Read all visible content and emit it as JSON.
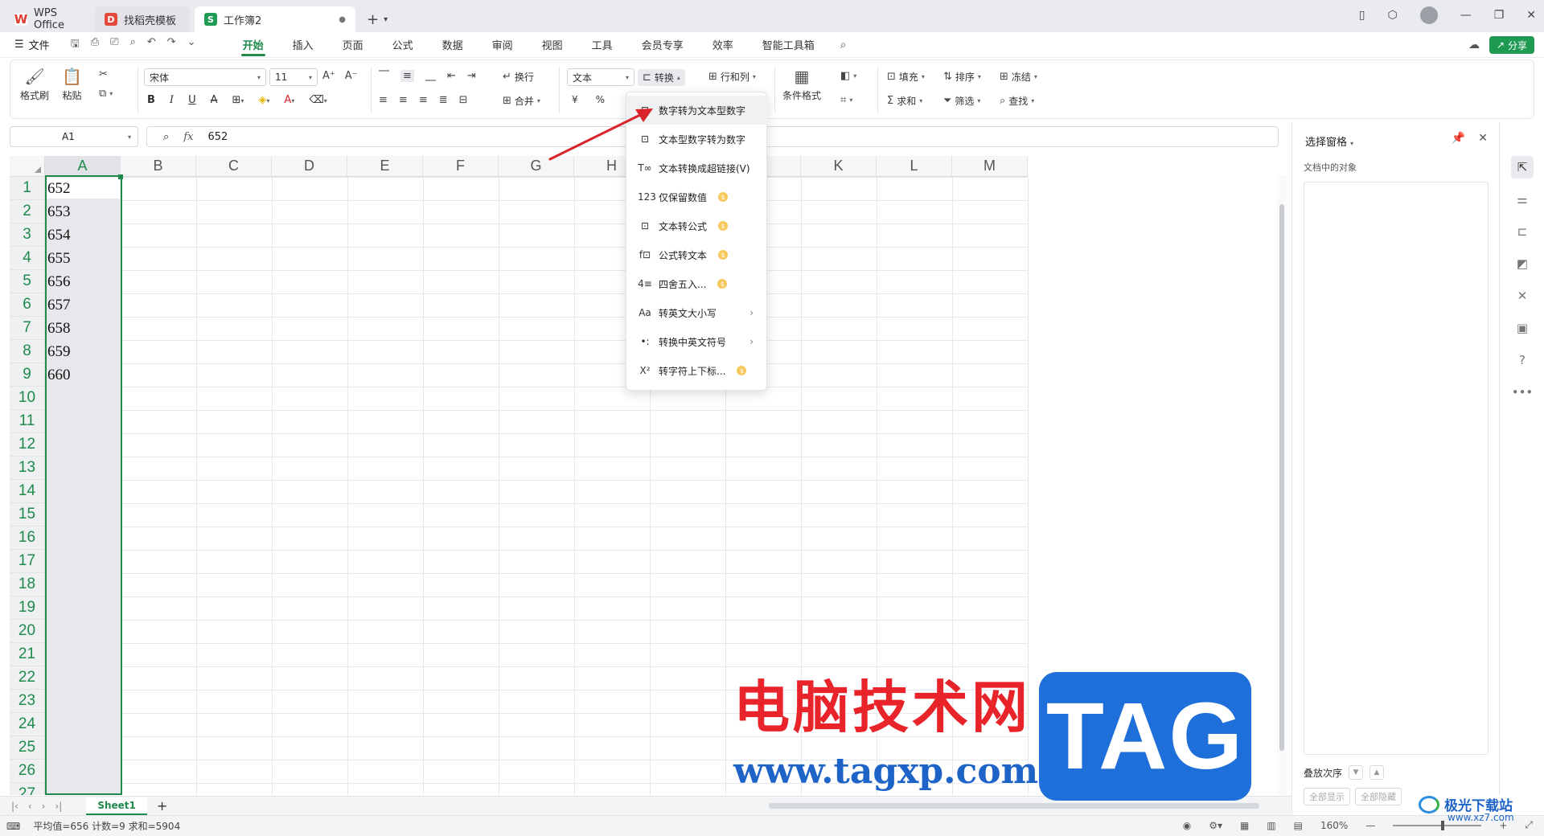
{
  "tabs": [
    {
      "label": "WPS Office",
      "logo": "W"
    },
    {
      "label": "找稻壳模板",
      "logo": "D"
    },
    {
      "label": "工作簿2",
      "logo": "S"
    }
  ],
  "menu": {
    "file": "文件",
    "items": [
      "开始",
      "插入",
      "页面",
      "公式",
      "数据",
      "审阅",
      "视图",
      "工具",
      "会员专享",
      "效率",
      "智能工具箱"
    ],
    "active": "开始",
    "share": "分享"
  },
  "ribbon": {
    "format_painter": "格式刷",
    "paste": "粘贴",
    "font_name": "宋体",
    "font_size": "11",
    "wrap": "换行",
    "merge": "合并",
    "number_format": "文本",
    "convert": "转换",
    "row_col": "行和列",
    "cond_format": "条件格式",
    "fill": "填充",
    "sort": "排序",
    "freeze": "冻结",
    "sum": "求和",
    "filter": "筛选",
    "find": "查找",
    "currency": "¥",
    "percent": "%"
  },
  "formula_bar": {
    "name_box": "A1",
    "fx": "fx",
    "value": "652"
  },
  "grid": {
    "columns": [
      "A",
      "B",
      "C",
      "D",
      "E",
      "F",
      "G",
      "H",
      "I",
      "J",
      "K",
      "L",
      "M"
    ],
    "rows": [
      "1",
      "2",
      "3",
      "4",
      "5",
      "6",
      "7",
      "8",
      "9",
      "10",
      "11",
      "12",
      "13",
      "14",
      "15",
      "16",
      "17",
      "18",
      "19",
      "20",
      "21",
      "22",
      "23",
      "24",
      "25",
      "26",
      "27"
    ],
    "colA_values": [
      "652",
      "653",
      "654",
      "655",
      "656",
      "657",
      "658",
      "659",
      "660"
    ]
  },
  "dropdown": {
    "items": [
      {
        "label": "数字转为文本型数字",
        "icon": "num-to-text-icon",
        "glyph": "⊡",
        "coin": false,
        "submenu": false
      },
      {
        "label": "文本型数字转为数字",
        "icon": "text-to-num-icon",
        "glyph": "⊡",
        "coin": false,
        "submenu": false
      },
      {
        "label": "文本转换成超链接(V)",
        "icon": "hyperlink-icon",
        "glyph": "T∞",
        "coin": false,
        "submenu": false
      },
      {
        "label": "仅保留数值",
        "icon": "keep-values-icon",
        "glyph": "123",
        "coin": true,
        "submenu": false
      },
      {
        "label": "文本转公式",
        "icon": "text-to-formula-icon",
        "glyph": "⊡",
        "coin": true,
        "submenu": false
      },
      {
        "label": "公式转文本",
        "icon": "formula-to-text-icon",
        "glyph": "f⊡",
        "coin": true,
        "submenu": false
      },
      {
        "label": "四舍五入...",
        "icon": "round-icon",
        "glyph": "4≡",
        "coin": true,
        "submenu": false
      },
      {
        "label": "转英文大小写",
        "icon": "case-icon",
        "glyph": "Aa",
        "coin": false,
        "submenu": true
      },
      {
        "label": "转换中英文符号",
        "icon": "symbol-icon",
        "glyph": "•:",
        "coin": false,
        "submenu": true
      },
      {
        "label": "转字符上下标...",
        "icon": "superscript-icon",
        "glyph": "X²",
        "coin": true,
        "submenu": false
      }
    ]
  },
  "sheets": {
    "tabs": [
      "Sheet1"
    ],
    "add": "+"
  },
  "status": {
    "text": "平均值=656  计数=9  求和=5904",
    "zoom": "160%"
  },
  "pane": {
    "title": "选择窗格",
    "subtitle": "文档中的对象",
    "order_label": "叠放次序",
    "show_all": "全部显示",
    "hide_all": "全部隐藏"
  },
  "watermark": {
    "cn_text": "电脑技术网",
    "url": "www.tagxp.com",
    "tag": "TAG",
    "site": "极光下载站",
    "site_url": "www.xz7.com"
  },
  "colors": {
    "accent": "#1f8a4c",
    "share": "#1e9a52",
    "arrow": "#d9242a",
    "wm_red": "#e8242a",
    "wm_blue": "#1e6fd9"
  }
}
